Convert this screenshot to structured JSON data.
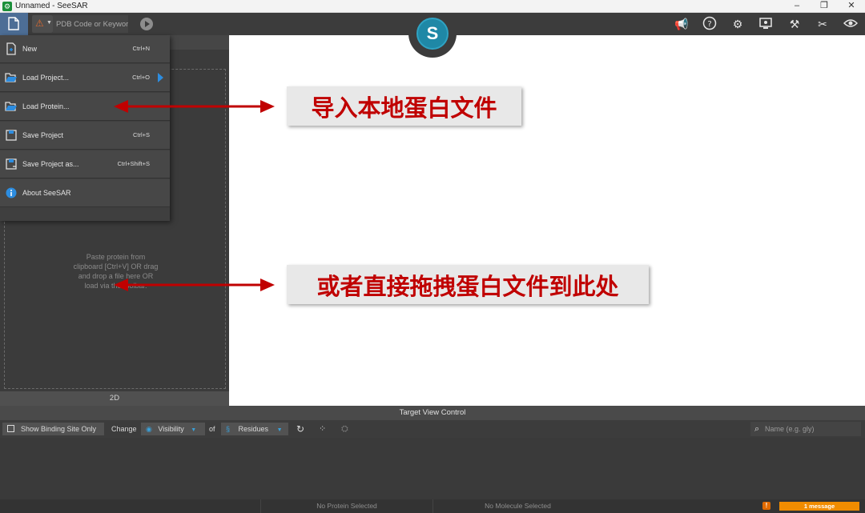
{
  "window": {
    "title": "Unnamed - SeeSAR",
    "minimize": "–",
    "restore": "❐",
    "close": "✕"
  },
  "toolbar": {
    "search_placeholder": "PDB Code or Keyword",
    "logo_letter": "S"
  },
  "menu": {
    "items": [
      {
        "label": "New",
        "shortcut": "Ctrl+N"
      },
      {
        "label": "Load Project...",
        "shortcut": "Ctrl+O"
      },
      {
        "label": "Load Protein...",
        "shortcut": ""
      },
      {
        "label": "Save Project",
        "shortcut": "Ctrl+S"
      },
      {
        "label": "Save Project as...",
        "shortcut": "Ctrl+Shift+S"
      },
      {
        "label": "About SeeSAR",
        "shortcut": ""
      }
    ]
  },
  "left_panel": {
    "drop_hint_lines": [
      "Paste protein from",
      "clipboard [Ctrl+V] OR drag",
      "and drop a file here OR",
      "load via the toolbar."
    ],
    "tab_2d": "2D"
  },
  "annotations": {
    "callout_1": "导入本地蛋白文件",
    "callout_2": "或者直接拖拽蛋白文件到此处",
    "accent_color": "#c00000"
  },
  "target_view": {
    "header": "Target View Control",
    "show_binding_site": "Show Binding Site Only",
    "change": "Change",
    "visibility": "Visibility",
    "of": "of",
    "residues": "Residues",
    "name_placeholder": "Name (e.g. gly)"
  },
  "status": {
    "protein": "No Protein Selected",
    "molecule": "No Molecule Selected",
    "warning_mark": "!",
    "messages": "1 message"
  }
}
